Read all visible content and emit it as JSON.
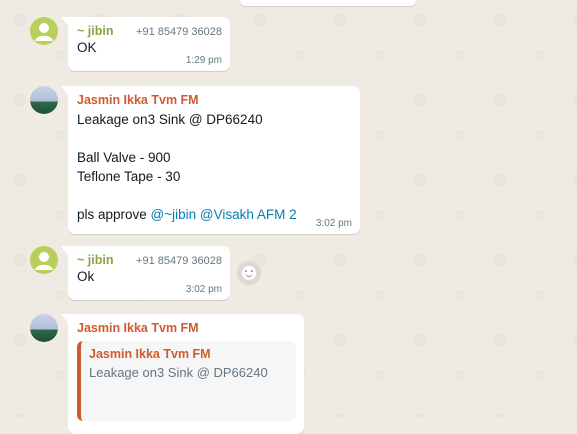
{
  "messages": [
    {
      "sender": "~ jibin",
      "phone": "+91 85479 36028",
      "text": "OK",
      "time": "1:29 pm"
    },
    {
      "sender": "Jasmin Ikka Tvm FM",
      "lines": [
        "Leakage on3 Sink @ DP66240",
        "",
        "Ball Valve - 900",
        "Teflone Tape - 30",
        ""
      ],
      "last_line_prefix": "pls approve ",
      "mention1": "@~jibin",
      "mention2": "@Visakh AFM 2",
      "time": "3:02 pm"
    },
    {
      "sender": "~ jibin",
      "phone": "+91 85479 36028",
      "text": "Ok",
      "time": "3:02 pm"
    },
    {
      "sender": "Jasmin Ikka Tvm FM",
      "quoted_sender": "Jasmin Ikka Tvm FM",
      "quoted_text": "Leakage on3 Sink @ DP66240"
    }
  ],
  "colors": {
    "background": "#efeae2",
    "bubble": "#ffffff",
    "sender_green": "#8aa43e",
    "sender_orange": "#d05a30",
    "mention": "#027eb5"
  }
}
